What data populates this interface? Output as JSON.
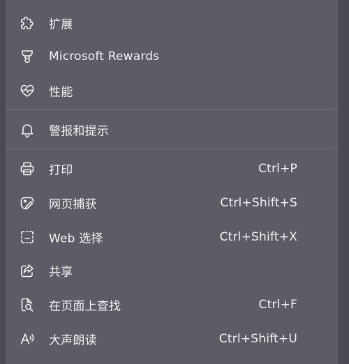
{
  "menu": {
    "items": [
      {
        "label": "扩展",
        "shortcut": "",
        "icon": "puzzle-icon"
      },
      {
        "label": "Microsoft Rewards",
        "shortcut": "",
        "icon": "rewards-trophy-icon"
      },
      {
        "label": "性能",
        "shortcut": "",
        "icon": "heart-pulse-icon"
      },
      {
        "label": "警报和提示",
        "shortcut": "",
        "icon": "bell-icon"
      },
      {
        "label": "打印",
        "shortcut": "Ctrl+P",
        "icon": "printer-icon"
      },
      {
        "label": "网页捕获",
        "shortcut": "Ctrl+Shift+S",
        "icon": "capture-icon"
      },
      {
        "label": "Web 选择",
        "shortcut": "Ctrl+Shift+X",
        "icon": "web-select-icon"
      },
      {
        "label": "共享",
        "shortcut": "",
        "icon": "share-icon"
      },
      {
        "label": "在页面上查找",
        "shortcut": "Ctrl+F",
        "icon": "find-page-icon"
      },
      {
        "label": "大声朗读",
        "shortcut": "Ctrl+Shift+U",
        "icon": "read-aloud-icon"
      }
    ]
  }
}
